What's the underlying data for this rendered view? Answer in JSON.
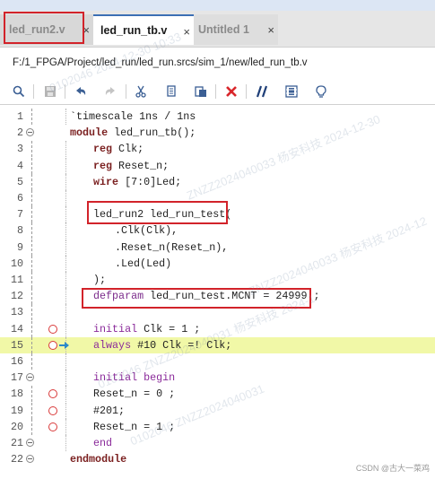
{
  "tabs": [
    {
      "label": "led_run2.v",
      "close": "×"
    },
    {
      "label": "led_run_tb.v",
      "close": "×"
    },
    {
      "label": "Untitled 1",
      "close": "×"
    }
  ],
  "file_path": "F:/1_FPGA/Project/led_run/led_run.srcs/sim_1/new/led_run_tb.v",
  "toolbar_icons": [
    "search-icon",
    "save-icon",
    "undo-icon",
    "redo-icon",
    "cut-icon",
    "copy-icon",
    "paste-icon",
    "delete-icon",
    "comment-icon",
    "block-icon",
    "bulb-icon"
  ],
  "code_lines": [
    {
      "n": "1",
      "indent": 1,
      "parts": [
        {
          "t": "`timescale 1ns / 1ns",
          "c": ""
        }
      ]
    },
    {
      "n": "2",
      "indent": 0,
      "fold": true,
      "parts": [
        {
          "t": "module",
          "c": "kw"
        },
        {
          "t": " led_run_tb();",
          "c": ""
        }
      ]
    },
    {
      "n": "3",
      "indent": 2,
      "parts": [
        {
          "t": "reg",
          "c": "kw"
        },
        {
          "t": " Clk;",
          "c": ""
        }
      ]
    },
    {
      "n": "4",
      "indent": 2,
      "parts": [
        {
          "t": "reg",
          "c": "kw"
        },
        {
          "t": " Reset_n;",
          "c": ""
        }
      ]
    },
    {
      "n": "5",
      "indent": 2,
      "parts": [
        {
          "t": "wire",
          "c": "kw"
        },
        {
          "t": " [7:0]Led;",
          "c": ""
        }
      ]
    },
    {
      "n": "6",
      "indent": 2,
      "parts": []
    },
    {
      "n": "7",
      "indent": 2,
      "parts": [
        {
          "t": "led_run2 led_run_test(",
          "c": ""
        }
      ]
    },
    {
      "n": "8",
      "indent": 3,
      "parts": [
        {
          "t": ".Clk(Clk),",
          "c": ""
        }
      ]
    },
    {
      "n": "9",
      "indent": 3,
      "parts": [
        {
          "t": ".Reset_n(Reset_n),",
          "c": ""
        }
      ]
    },
    {
      "n": "10",
      "indent": 3,
      "parts": [
        {
          "t": ".Led(Led)",
          "c": ""
        }
      ]
    },
    {
      "n": "11",
      "indent": 2,
      "parts": [
        {
          "t": ");",
          "c": ""
        }
      ]
    },
    {
      "n": "12",
      "indent": 2,
      "parts": [
        {
          "t": "defparam",
          "c": "def"
        },
        {
          "t": " led_run_test.MCNT = 24999 ;",
          "c": ""
        }
      ]
    },
    {
      "n": "13",
      "indent": 2,
      "parts": []
    },
    {
      "n": "14",
      "indent": 2,
      "bp": true,
      "parts": [
        {
          "t": "initial",
          "c": "pur"
        },
        {
          "t": " Clk = 1 ;",
          "c": ""
        }
      ]
    },
    {
      "n": "15",
      "indent": 2,
      "bp": true,
      "arrow": true,
      "hl": true,
      "parts": [
        {
          "t": "always",
          "c": "pur"
        },
        {
          "t": " #10 Clk =! Clk;",
          "c": ""
        }
      ]
    },
    {
      "n": "16",
      "indent": 2,
      "parts": []
    },
    {
      "n": "17",
      "indent": 2,
      "fold": true,
      "parts": [
        {
          "t": "initial begin",
          "c": "pur"
        }
      ]
    },
    {
      "n": "18",
      "indent": 2,
      "bp": true,
      "parts": [
        {
          "t": "Reset_n = 0 ;",
          "c": ""
        }
      ]
    },
    {
      "n": "19",
      "indent": 2,
      "bp": true,
      "parts": [
        {
          "t": "#201;",
          "c": ""
        }
      ]
    },
    {
      "n": "20",
      "indent": 2,
      "bp": true,
      "parts": [
        {
          "t": "Reset_n = 1 ;",
          "c": ""
        }
      ]
    },
    {
      "n": "21",
      "indent": 2,
      "fold": true,
      "parts": [
        {
          "t": "end",
          "c": "pur"
        }
      ]
    },
    {
      "n": "22",
      "indent": 0,
      "fold": true,
      "parts": [
        {
          "t": "endmodule",
          "c": "kw"
        }
      ]
    }
  ],
  "watermarks": [
    "0102046 2024-12-30 10:33",
    "ZNZZ2024040033 杨安科技 2024-12-30",
    "ZNZZ2024040033 杨安科技 2024-12",
    "0102046 ZNZZ2024040031 杨安科技 2024-1",
    "0102046 ZNZZ2024040031"
  ],
  "footer": "CSDN @古大一菜鸡"
}
